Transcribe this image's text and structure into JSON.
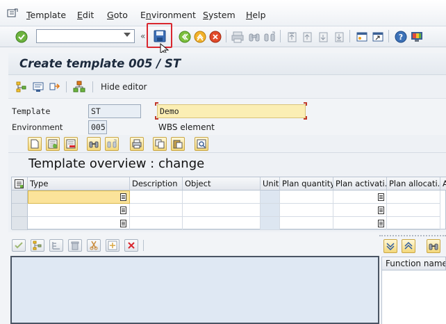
{
  "menu": {
    "items": [
      "Template",
      "Edit",
      "Goto",
      "Environment",
      "System",
      "Help"
    ],
    "mnemonics": [
      "T",
      "E",
      "G",
      "n",
      "S",
      "H"
    ]
  },
  "toolbar": {
    "command_field_value": "",
    "icons": [
      "enter-icon",
      "save-icon",
      "back-icon",
      "exit-icon",
      "cancel-icon",
      "print-icon",
      "find-icon",
      "find-next-icon",
      "first-page-icon",
      "prev-page-icon",
      "next-page-icon",
      "last-page-icon",
      "new-session-icon",
      "shortcut-icon",
      "help-icon",
      "customize-layout-icon"
    ]
  },
  "title": "Create template 005 / ST",
  "app_toolbar": {
    "hide_editor_label": "Hide editor"
  },
  "form": {
    "template_label": "Template",
    "template_value": "ST",
    "description_value": "Demo",
    "environment_label": "Environment",
    "environment_value": "005",
    "wbs_label": "WBS element"
  },
  "overview": {
    "title": "Template overview : change",
    "columns": [
      "Type",
      "Description",
      "Object",
      "Unit",
      "Plan quantity",
      "Plan activati...",
      "Plan allocati...",
      "A"
    ],
    "rows": [
      [
        "",
        "",
        "",
        "",
        "",
        "",
        "",
        ""
      ],
      [
        "",
        "",
        "",
        "",
        "",
        "",
        "",
        ""
      ],
      [
        "",
        "",
        "",
        "",
        "",
        "",
        "",
        ""
      ]
    ]
  },
  "right_panel": {
    "header": "Function name"
  },
  "colors": {
    "accent": "#1c2a3d",
    "highlight_box": "#d9262e",
    "required_field": "#fbeeb4"
  }
}
